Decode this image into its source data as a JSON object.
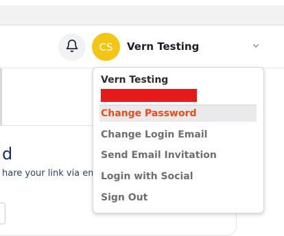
{
  "header": {
    "avatar_initials": "CS",
    "user_name": "Vern Testing",
    "bell_icon": "bell-icon",
    "chevron_icon": "chevron-down-icon"
  },
  "card": {
    "title": "d",
    "text": "hare your link via em"
  },
  "dropdown": {
    "name": "Vern Testing",
    "items": [
      {
        "label": "Change Password",
        "active": true
      },
      {
        "label": "Change Login Email",
        "active": false
      },
      {
        "label": "Send Email Invitation",
        "active": false
      },
      {
        "label": "Login with Social",
        "active": false
      },
      {
        "label": "Sign Out",
        "active": false
      }
    ]
  },
  "colors": {
    "accent": "#ee4a16",
    "avatar": "#f3c515",
    "redaction": "#e31b1b"
  }
}
